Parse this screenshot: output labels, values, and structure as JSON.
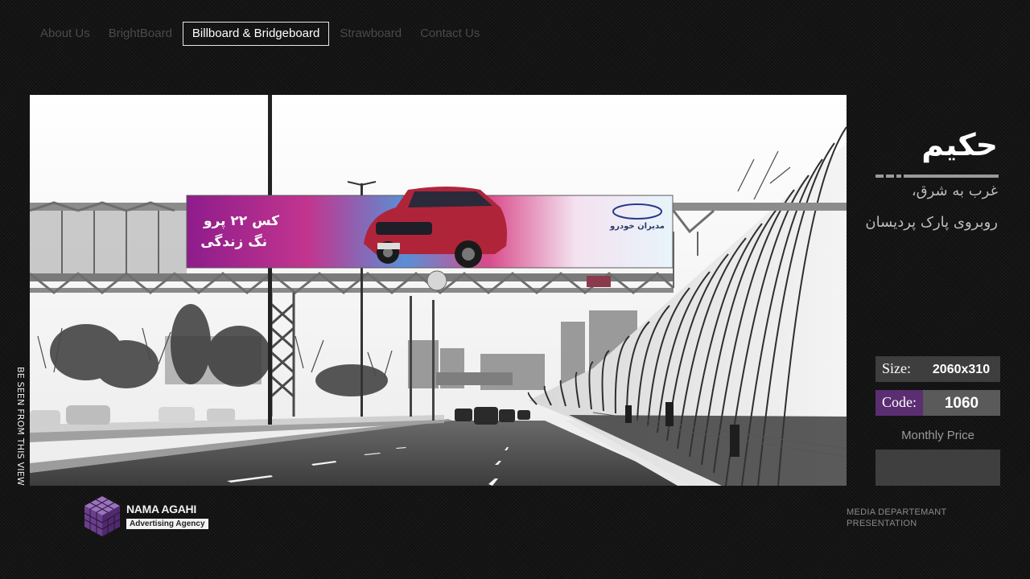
{
  "nav": {
    "items": [
      {
        "label": "About Us"
      },
      {
        "label": "BrightBoard"
      },
      {
        "label": "Billboard & Bridgeboard"
      },
      {
        "label": "Strawboard"
      },
      {
        "label": "Contact Us"
      }
    ],
    "active_index": 2
  },
  "photo": {
    "caption": "BE SEEN FROM THIS VIEW",
    "billboard_text_left_1": "کس ۲۲ پرو",
    "billboard_text_left_2": "نگ زندگی",
    "billboard_brand": "مدیران خودرو"
  },
  "location": {
    "title": "حکیم",
    "direction": "غرب به شرق،",
    "landmark": "روبروی پارک پردیسان"
  },
  "specs": {
    "size_label": "Size:",
    "size_value": "2060x310",
    "code_label": "Code:",
    "code_value": "1060",
    "monthly_price_label": "Monthly Price",
    "monthly_price_value": ""
  },
  "footer": {
    "brand_name": "NAMA AGAHI",
    "brand_tagline": "Advertising Agency",
    "note_line1": "MEDIA DEPARTEMANT",
    "note_line2": "PRESENTATION"
  },
  "colors": {
    "background": "#141414",
    "code_accent": "#5b2e72",
    "panel_gray": "#3e3e3e",
    "logo_purple": "#7a4e9c"
  }
}
